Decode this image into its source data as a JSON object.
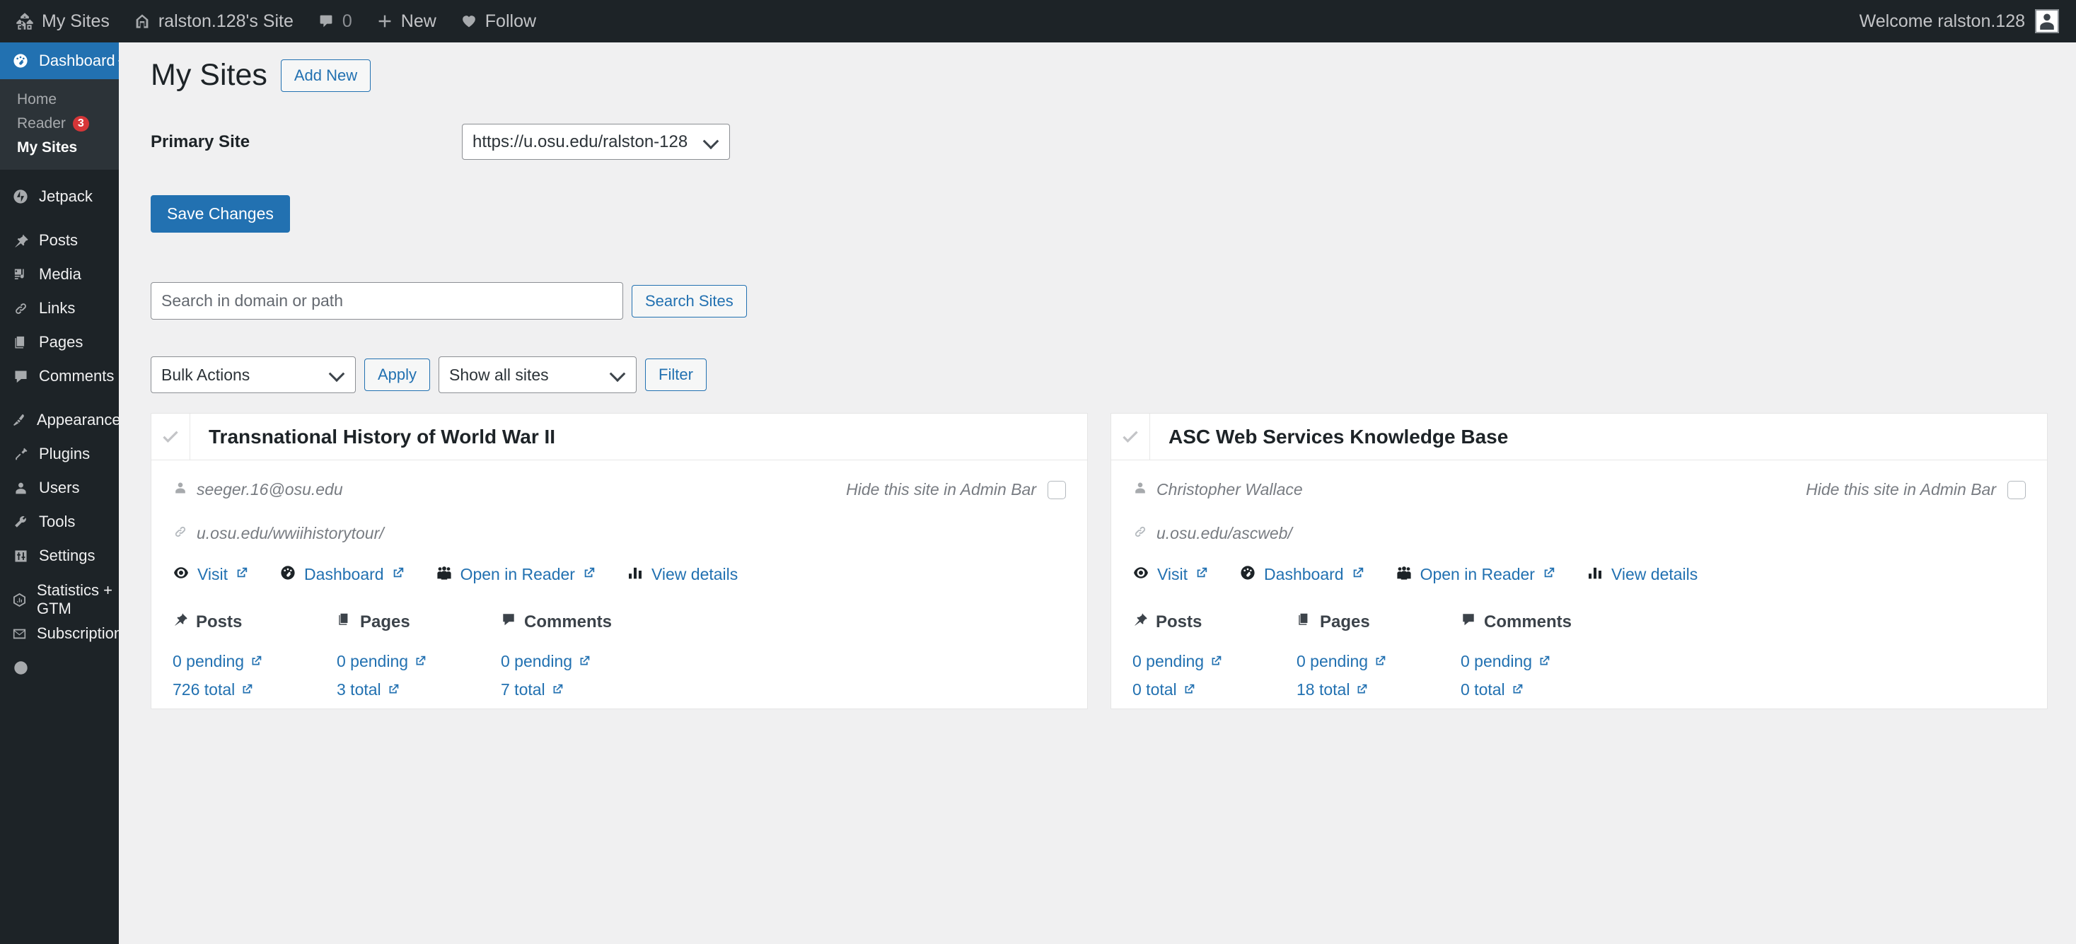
{
  "adminbar": {
    "my_sites": "My Sites",
    "site_name": "ralston.128's Site",
    "comment_count": "0",
    "new_label": "New",
    "follow_label": "Follow",
    "welcome": "Welcome ralston.128"
  },
  "sidebar": {
    "dashboard": "Dashboard",
    "sub": [
      {
        "label": "Home",
        "badge": "",
        "current": false
      },
      {
        "label": "Reader",
        "badge": "3",
        "current": false
      },
      {
        "label": "My Sites",
        "badge": "",
        "current": true
      }
    ],
    "items": [
      {
        "label": "Jetpack"
      },
      {
        "label": "Posts"
      },
      {
        "label": "Media"
      },
      {
        "label": "Links"
      },
      {
        "label": "Pages"
      },
      {
        "label": "Comments"
      },
      {
        "label": "Appearance"
      },
      {
        "label": "Plugins"
      },
      {
        "label": "Users"
      },
      {
        "label": "Tools"
      },
      {
        "label": "Settings"
      },
      {
        "label": "Statistics + GTM"
      },
      {
        "label": "Subscriptions"
      }
    ]
  },
  "page": {
    "title": "My Sites",
    "add_new": "Add New",
    "primary_site_label": "Primary Site",
    "primary_site_value": "https://u.osu.edu/ralston-128",
    "save_changes": "Save Changes",
    "search_placeholder": "Search in domain or path",
    "search_value": "",
    "search_button": "Search Sites",
    "bulk_actions": "Bulk Actions",
    "apply": "Apply",
    "show_all_sites": "Show all sites",
    "filter": "Filter"
  },
  "labels": {
    "hide_in_admin_bar": "Hide this site in Admin Bar",
    "visit": "Visit",
    "dashboard": "Dashboard",
    "open_in_reader": "Open in Reader",
    "view_details": "View details",
    "posts": "Posts",
    "pages": "Pages",
    "comments": "Comments"
  },
  "colors": {
    "accent": "#2271b1",
    "sidebar_bg": "#1d2327",
    "submenu_bg": "#2c3338",
    "badge": "#d63638",
    "page_bg": "#f0f0f1"
  },
  "sites": [
    {
      "title": "Transnational History of World War II",
      "owner": "seeger.16@osu.edu",
      "url": "u.osu.edu/wwiihistorytour/",
      "stats": {
        "posts": {
          "pending": "0 pending",
          "total": "726 total"
        },
        "pages": {
          "pending": "0 pending",
          "total": "3 total"
        },
        "comments": {
          "pending": "0 pending",
          "total": "7 total"
        }
      }
    },
    {
      "title": "ASC Web Services Knowledge Base",
      "owner": "Christopher Wallace",
      "url": "u.osu.edu/ascweb/",
      "stats": {
        "posts": {
          "pending": "0 pending",
          "total": "0 total"
        },
        "pages": {
          "pending": "0 pending",
          "total": "18 total"
        },
        "comments": {
          "pending": "0 pending",
          "total": "0 total"
        }
      }
    }
  ]
}
